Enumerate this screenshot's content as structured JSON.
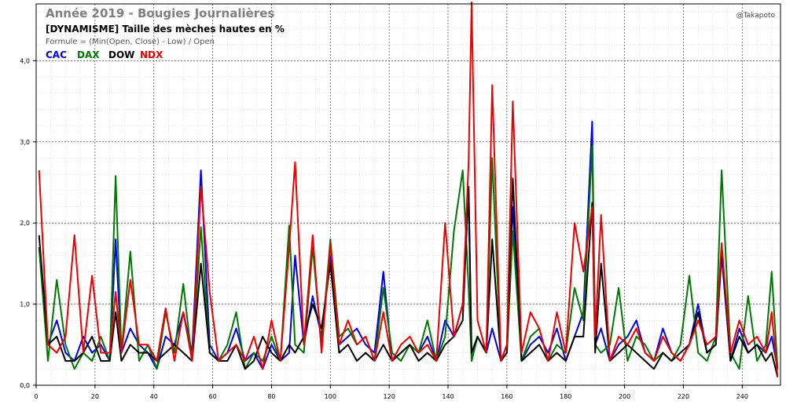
{
  "chart_data": {
    "type": "line",
    "title": "Année 2019 - Bougies Journalières",
    "subtitle": "[DYNAMISME] Taille des mèches hautes en %",
    "formula": "Formule = (Min(Open, Close) - Low) / Open",
    "credit": "@Takapoto",
    "xlim": [
      0,
      253
    ],
    "ylim": [
      0,
      4.7
    ],
    "xticks": [
      0,
      20,
      40,
      60,
      80,
      100,
      120,
      140,
      160,
      180,
      200,
      220,
      240
    ],
    "xtick_labels": [
      "0",
      "20",
      "40",
      "60",
      "80",
      "100",
      "120",
      "140",
      "160",
      "180",
      "200",
      "220",
      "240"
    ],
    "yticks": [
      0,
      1,
      2,
      3,
      4
    ],
    "ytick_labels": [
      "0,0",
      "1,0",
      "2,0",
      "3,0",
      "4,0"
    ],
    "grid": true,
    "legend_position": "top-left",
    "x": [
      1,
      4,
      7,
      10,
      13,
      16,
      19,
      22,
      25,
      27,
      29,
      32,
      35,
      38,
      41,
      44,
      47,
      50,
      53,
      56,
      59,
      62,
      65,
      68,
      71,
      74,
      77,
      80,
      83,
      86,
      88,
      91,
      94,
      97,
      100,
      103,
      106,
      109,
      112,
      115,
      118,
      121,
      124,
      127,
      130,
      133,
      136,
      139,
      142,
      145,
      147,
      148,
      150,
      153,
      155,
      158,
      160,
      162,
      165,
      168,
      171,
      174,
      177,
      180,
      183,
      186,
      189,
      190,
      192,
      195,
      198,
      201,
      204,
      207,
      210,
      213,
      216,
      219,
      222,
      225,
      228,
      231,
      233,
      236,
      239,
      242,
      245,
      248,
      250,
      252
    ],
    "series": [
      {
        "name": "CAC",
        "color": "#0000dd",
        "values": [
          1.7,
          0.5,
          0.8,
          0.4,
          0.3,
          0.6,
          0.4,
          0.5,
          0.3,
          1.8,
          0.4,
          0.7,
          0.5,
          0.4,
          0.2,
          0.6,
          0.5,
          0.9,
          0.4,
          2.65,
          0.5,
          0.3,
          0.4,
          0.7,
          0.3,
          0.4,
          0.2,
          0.5,
          0.3,
          0.4,
          1.6,
          0.5,
          1.1,
          0.6,
          1.6,
          0.5,
          0.6,
          0.7,
          0.5,
          0.4,
          1.4,
          0.3,
          0.4,
          0.5,
          0.4,
          0.6,
          0.3,
          0.8,
          0.6,
          1.0,
          2.4,
          0.3,
          0.6,
          0.4,
          0.7,
          0.3,
          0.5,
          2.2,
          0.3,
          0.5,
          0.6,
          0.4,
          0.7,
          0.3,
          0.6,
          0.9,
          3.25,
          0.5,
          0.7,
          0.3,
          0.5,
          0.6,
          0.8,
          0.4,
          0.3,
          0.7,
          0.4,
          0.3,
          0.5,
          1.0,
          0.4,
          0.5,
          1.6,
          0.3,
          0.7,
          0.4,
          0.5,
          0.4,
          0.6,
          0.2
        ]
      },
      {
        "name": "DAX",
        "color": "#007700",
        "values": [
          1.7,
          0.3,
          1.3,
          0.5,
          0.2,
          0.4,
          0.3,
          0.6,
          0.3,
          2.58,
          0.4,
          1.65,
          0.3,
          0.5,
          0.2,
          0.9,
          0.4,
          1.25,
          0.3,
          1.95,
          0.4,
          0.3,
          0.5,
          0.9,
          0.2,
          0.4,
          0.3,
          0.6,
          0.3,
          1.97,
          0.5,
          0.4,
          1.7,
          0.5,
          1.8,
          0.6,
          0.7,
          0.5,
          0.6,
          0.3,
          1.2,
          0.4,
          0.3,
          0.5,
          0.4,
          0.8,
          0.3,
          0.6,
          1.9,
          2.65,
          1.2,
          0.3,
          0.6,
          0.4,
          2.8,
          0.3,
          0.4,
          1.9,
          0.3,
          0.6,
          0.7,
          0.3,
          0.5,
          0.4,
          1.2,
          0.8,
          2.95,
          0.5,
          0.4,
          0.5,
          1.2,
          0.3,
          0.6,
          0.5,
          0.3,
          0.4,
          0.3,
          0.5,
          1.35,
          0.4,
          0.3,
          0.6,
          2.65,
          0.4,
          0.2,
          1.1,
          0.3,
          0.5,
          1.4,
          0.2
        ]
      },
      {
        "name": "DOW",
        "color": "#000000",
        "values": [
          1.85,
          0.5,
          0.6,
          0.3,
          0.3,
          0.4,
          0.6,
          0.3,
          0.3,
          0.9,
          0.3,
          0.5,
          0.4,
          0.4,
          0.3,
          0.4,
          0.5,
          0.4,
          0.3,
          1.5,
          0.4,
          0.3,
          0.3,
          0.5,
          0.2,
          0.3,
          0.6,
          0.4,
          0.3,
          0.5,
          0.4,
          0.6,
          1.0,
          0.7,
          1.5,
          0.4,
          0.5,
          0.3,
          0.4,
          0.3,
          0.5,
          0.3,
          0.4,
          0.5,
          0.3,
          0.4,
          0.3,
          0.5,
          0.6,
          0.8,
          2.45,
          0.4,
          0.6,
          0.4,
          1.8,
          0.3,
          0.4,
          2.55,
          0.3,
          0.4,
          0.5,
          0.3,
          0.4,
          0.3,
          0.6,
          0.6,
          2.25,
          0.4,
          1.5,
          0.3,
          0.4,
          0.5,
          0.4,
          0.3,
          0.2,
          0.4,
          0.3,
          0.4,
          0.5,
          0.9,
          0.4,
          0.5,
          1.7,
          0.3,
          0.6,
          0.4,
          0.5,
          0.3,
          0.4,
          0.1
        ]
      },
      {
        "name": "NDX",
        "color": "#ee0000",
        "values": [
          2.65,
          0.5,
          0.4,
          0.6,
          1.85,
          0.4,
          1.35,
          0.4,
          0.4,
          1.15,
          0.4,
          1.3,
          0.5,
          0.5,
          0.3,
          0.95,
          0.3,
          0.9,
          0.3,
          2.45,
          1.15,
          0.3,
          0.4,
          0.5,
          0.3,
          0.6,
          0.2,
          0.8,
          0.3,
          1.7,
          2.75,
          0.5,
          1.85,
          0.4,
          1.75,
          0.5,
          0.8,
          0.5,
          0.6,
          0.3,
          0.9,
          0.3,
          0.5,
          0.6,
          0.4,
          0.5,
          0.3,
          2.0,
          0.6,
          1.0,
          2.75,
          4.72,
          0.8,
          0.4,
          3.7,
          0.3,
          0.5,
          3.5,
          0.4,
          0.9,
          0.7,
          0.3,
          0.9,
          0.4,
          2.0,
          1.4,
          2.2,
          0.6,
          2.1,
          0.3,
          0.6,
          0.5,
          0.7,
          0.4,
          0.3,
          0.6,
          0.4,
          0.3,
          0.5,
          0.8,
          0.5,
          0.6,
          1.75,
          0.4,
          0.8,
          0.5,
          0.6,
          0.4,
          0.9,
          0.1
        ]
      }
    ]
  }
}
